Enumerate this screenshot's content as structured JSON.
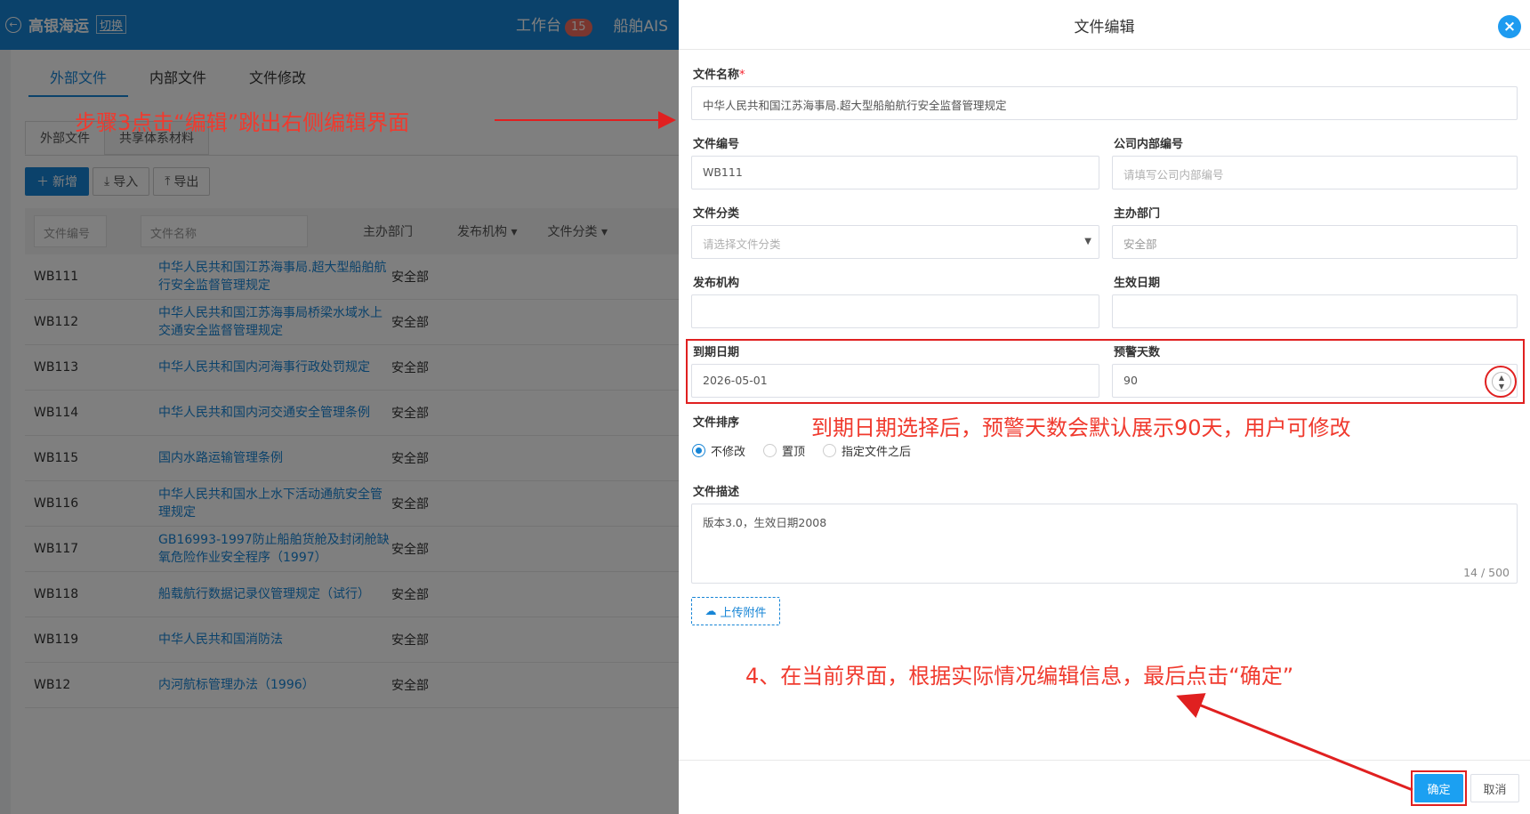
{
  "app": {
    "brand": "高银海运",
    "switch_label": "切换",
    "nav": [
      {
        "label": "工作台",
        "badge": "15"
      },
      {
        "label": "船舶AIS"
      }
    ]
  },
  "main_tabs": [
    "外部文件",
    "内部文件",
    "文件修改"
  ],
  "sub_tabs": [
    "外部文件",
    "共享体系材料"
  ],
  "toolbar": {
    "add": "新增",
    "import": "导入",
    "export": "导出"
  },
  "table": {
    "filters": {
      "file_no": "文件编号",
      "file_name": "文件名称"
    },
    "headers": {
      "dept": "主办部门",
      "publisher": "发布机构",
      "category": "文件分类"
    },
    "rows": [
      {
        "no": "WB111",
        "name": "中华人民共和国江苏海事局.超大型船舶航行安全监督管理规定",
        "dept": "安全部"
      },
      {
        "no": "WB112",
        "name": "中华人民共和国江苏海事局桥梁水域水上交通安全监督管理规定",
        "dept": "安全部"
      },
      {
        "no": "WB113",
        "name": "中华人民共和国内河海事行政处罚规定",
        "dept": "安全部"
      },
      {
        "no": "WB114",
        "name": "中华人民共和国内河交通安全管理条例",
        "dept": "安全部"
      },
      {
        "no": "WB115",
        "name": "国内水路运输管理条例",
        "dept": "安全部"
      },
      {
        "no": "WB116",
        "name": "中华人民共和国水上水下活动通航安全管理规定",
        "dept": "安全部"
      },
      {
        "no": "WB117",
        "name": "GB16993-1997防止船舶货舱及封闭舱缺氧危险作业安全程序（1997）",
        "dept": "安全部"
      },
      {
        "no": "WB118",
        "name": "船载航行数据记录仪管理规定（试行）",
        "dept": "安全部"
      },
      {
        "no": "WB119",
        "name": "中华人民共和国消防法",
        "dept": "安全部"
      },
      {
        "no": "WB12",
        "name": "内河航标管理办法（1996）",
        "dept": "安全部"
      }
    ]
  },
  "drawer": {
    "title": "文件编辑",
    "fields": {
      "file_name": {
        "label": "文件名称",
        "value": "中华人民共和国江苏海事局.超大型船舶航行安全监督管理规定"
      },
      "file_no": {
        "label": "文件编号",
        "value": "WB111"
      },
      "internal_no": {
        "label": "公司内部编号",
        "placeholder": "请填写公司内部编号"
      },
      "category": {
        "label": "文件分类",
        "placeholder": "请选择文件分类"
      },
      "dept": {
        "label": "主办部门",
        "value": "安全部"
      },
      "publisher": {
        "label": "发布机构",
        "value": ""
      },
      "effective_date": {
        "label": "生效日期",
        "value": ""
      },
      "expire_date": {
        "label": "到期日期",
        "value": "2026-05-01"
      },
      "warn_days": {
        "label": "预警天数",
        "value": "90"
      },
      "order": {
        "label": "文件排序",
        "options": [
          "不修改",
          "置顶",
          "指定文件之后"
        ],
        "selected": "不修改"
      },
      "desc": {
        "label": "文件描述",
        "value": "版本3.0，生效日期2008",
        "counter": "14 / 500"
      }
    },
    "upload_label": "上传附件",
    "ok_label": "确定",
    "cancel_label": "取消"
  },
  "annotations": {
    "step3": "步骤3点击“编辑”跳出右侧编辑界面",
    "warn_note": "到期日期选择后，预警天数会默认展示90天，用户可修改",
    "step4": "4、在当前界面，根据实际情况编辑信息，最后点击“确定”",
    "color": "#f03a2e"
  },
  "colors": {
    "primary": "#1785d6",
    "ok_button": "#1ba0f2"
  }
}
